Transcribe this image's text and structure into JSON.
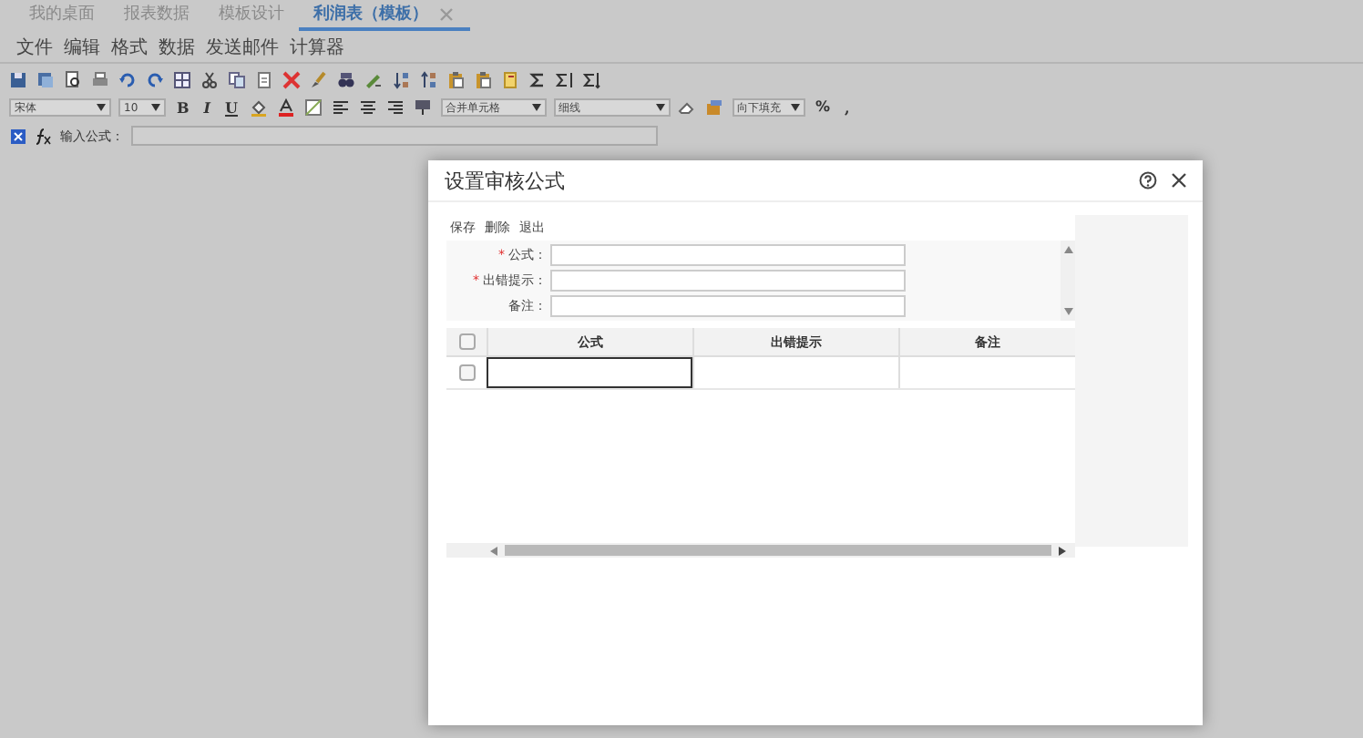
{
  "tabs": [
    {
      "label": "我的桌面",
      "selected": false,
      "closable": false
    },
    {
      "label": "报表数据",
      "selected": false,
      "closable": false
    },
    {
      "label": "模板设计",
      "selected": false,
      "closable": false
    },
    {
      "label": "利润表（模板）",
      "selected": true,
      "closable": true
    }
  ],
  "menu": [
    "文件",
    "编辑",
    "格式",
    "数据",
    "发送邮件",
    "计算器"
  ],
  "format_toolbar": {
    "font": "宋体",
    "size": "10",
    "style_buttons": [
      "B",
      "I",
      "U"
    ],
    "merge_select": "合并单元格",
    "border_select": "细线",
    "fill_select": "向下填充",
    "percent_button": "%",
    "comma_button": ","
  },
  "formula_bar": {
    "label": "输入公式："
  },
  "dialog": {
    "title": "设置审核公式",
    "actions": [
      "保存",
      "删除",
      "退出"
    ],
    "fields": [
      {
        "label": "公式：",
        "required": true
      },
      {
        "label": "出错提示：",
        "required": true
      },
      {
        "label": "备注：",
        "required": false
      }
    ],
    "required_mark": "*",
    "table": {
      "header_checked": false,
      "columns": [
        "公式",
        "出错提示",
        "备注"
      ],
      "rows": [
        {
          "checked": false,
          "editing": true
        }
      ]
    }
  }
}
